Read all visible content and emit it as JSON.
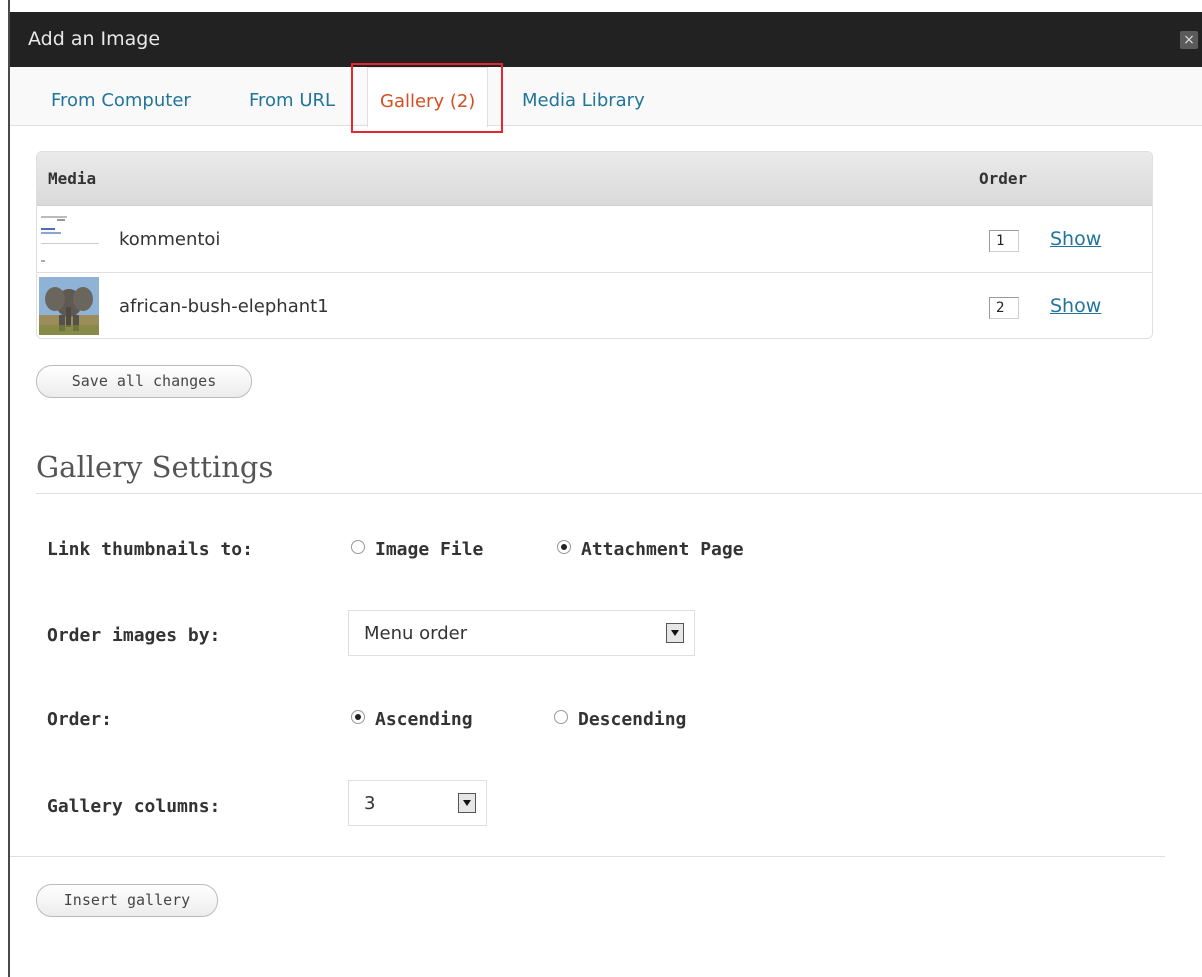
{
  "dialog": {
    "title": "Add an Image",
    "close_glyph": "×"
  },
  "tabs": [
    {
      "label": "From Computer"
    },
    {
      "label": "From URL"
    },
    {
      "label": "Gallery (2)"
    },
    {
      "label": "Media Library"
    }
  ],
  "media_table": {
    "headers": {
      "media": "Media",
      "order": "Order"
    },
    "rows": [
      {
        "name": "kommentoi",
        "order": "1",
        "action": "Show",
        "thumb": "document-thumbnail"
      },
      {
        "name": "african-bush-elephant1",
        "order": "2",
        "action": "Show",
        "thumb": "elephant-thumbnail"
      }
    ]
  },
  "buttons": {
    "save_all": "Save all changes",
    "insert_gallery": "Insert gallery"
  },
  "settings": {
    "title": "Gallery Settings",
    "link_thumbnails": {
      "label": "Link thumbnails to:",
      "options": [
        "Image File",
        "Attachment Page"
      ],
      "selected": "Attachment Page"
    },
    "order_by": {
      "label": "Order images by:",
      "value": "Menu order"
    },
    "order": {
      "label": "Order:",
      "options": [
        "Ascending",
        "Descending"
      ],
      "selected": "Ascending"
    },
    "columns": {
      "label": "Gallery columns:",
      "value": "3"
    }
  },
  "colors": {
    "link": "#21759b",
    "active_tab": "#d54e21",
    "highlight": "#e8262d",
    "titlebar": "#222222"
  }
}
